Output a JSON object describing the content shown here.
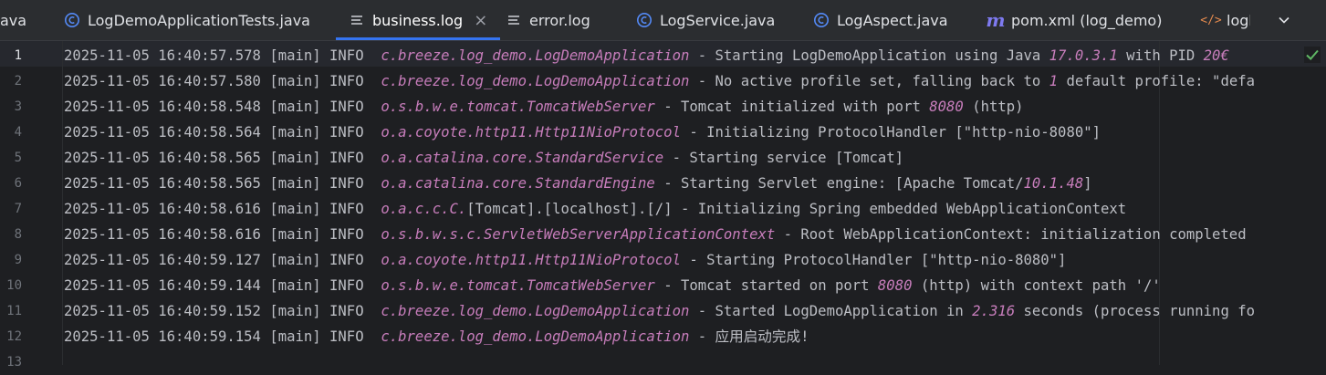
{
  "tabs": [
    {
      "label": "ava",
      "icon": "none",
      "active": false
    },
    {
      "label": "LogDemoApplicationTests.java",
      "icon": "java-class-icon",
      "active": false
    },
    {
      "label": "business.log",
      "icon": "log-file-icon",
      "active": true,
      "close": "×"
    },
    {
      "label": "error.log",
      "icon": "log-file-icon",
      "active": false
    },
    {
      "label": "LogService.java",
      "icon": "java-class-icon",
      "active": false
    },
    {
      "label": "LogAspect.java",
      "icon": "java-class-icon",
      "active": false
    },
    {
      "label": "pom.xml (log_demo)",
      "icon": "maven-icon",
      "active": false
    },
    {
      "label": "logb",
      "icon": "xml-icon",
      "active": false
    }
  ],
  "line_numbers": [
    "1",
    "2",
    "3",
    "4",
    "5",
    "6",
    "7",
    "8",
    "9",
    "10",
    "11",
    "12",
    "13"
  ],
  "log_lines": [
    {
      "prefix": "2025-11-05 16:40:57.578 [main] INFO  ",
      "logger": "c.breeze.log_demo.LogDemoApplication",
      "msg_a": " - Starting LogDemoApplication using Java ",
      "num": "17.0.3.1",
      "msg_b": " with PID ",
      "num2": "20€"
    },
    {
      "prefix": "2025-11-05 16:40:57.580 [main] INFO  ",
      "logger": "c.breeze.log_demo.LogDemoApplication",
      "msg_a": " - No active profile set, falling back to ",
      "num": "1",
      "msg_b": " default profile: \"defa",
      "num2": ""
    },
    {
      "prefix": "2025-11-05 16:40:58.548 [main] INFO  ",
      "logger": "o.s.b.w.e.tomcat.TomcatWebServer",
      "msg_a": " - Tomcat initialized with port ",
      "num": "8080",
      "msg_b": " (http)",
      "num2": ""
    },
    {
      "prefix": "2025-11-05 16:40:58.564 [main] INFO  ",
      "logger": "o.a.coyote.http11.Http11NioProtocol",
      "msg_a": " - Initializing ProtocolHandler [\"http-nio-8080\"]",
      "num": "",
      "msg_b": "",
      "num2": ""
    },
    {
      "prefix": "2025-11-05 16:40:58.565 [main] INFO  ",
      "logger": "o.a.catalina.core.StandardService",
      "msg_a": " - Starting service [Tomcat]",
      "num": "",
      "msg_b": "",
      "num2": ""
    },
    {
      "prefix": "2025-11-05 16:40:58.565 [main] INFO  ",
      "logger": "o.a.catalina.core.StandardEngine",
      "msg_a": " - Starting Servlet engine: [Apache Tomcat/",
      "num": "10.1.48",
      "msg_b": "]",
      "num2": ""
    },
    {
      "prefix": "2025-11-05 16:40:58.616 [main] INFO  ",
      "logger": "o.a.c.c.C.",
      "msg_a": "[Tomcat].[localhost].[/] - Initializing Spring embedded WebApplicationContext",
      "num": "",
      "msg_b": "",
      "num2": ""
    },
    {
      "prefix": "2025-11-05 16:40:58.616 [main] INFO  ",
      "logger": "o.s.b.w.s.c.ServletWebServerApplicationContext",
      "msg_a": " - Root WebApplicationContext: initialization completed",
      "num": "",
      "msg_b": "",
      "num2": ""
    },
    {
      "prefix": "2025-11-05 16:40:59.127 [main] INFO  ",
      "logger": "o.a.coyote.http11.Http11NioProtocol",
      "msg_a": " - Starting ProtocolHandler [\"http-nio-8080\"]",
      "num": "",
      "msg_b": "",
      "num2": ""
    },
    {
      "prefix": "2025-11-05 16:40:59.144 [main] INFO  ",
      "logger": "o.s.b.w.e.tomcat.TomcatWebServer",
      "msg_a": " - Tomcat started on port ",
      "num": "8080",
      "msg_b": " (http) with context path '/'",
      "num2": ""
    },
    {
      "prefix": "2025-11-05 16:40:59.152 [main] INFO  ",
      "logger": "c.breeze.log_demo.LogDemoApplication",
      "msg_a": " - Started LogDemoApplication in ",
      "num": "2.316",
      "msg_b": " seconds (process running fo",
      "num2": ""
    },
    {
      "prefix": "2025-11-05 16:40:59.154 [main] INFO  ",
      "logger": "c.breeze.log_demo.LogDemoApplication",
      "msg_a": " - 应用启动完成!",
      "num": "",
      "msg_b": "",
      "num2": ""
    },
    {
      "prefix": "",
      "logger": "",
      "msg_a": "",
      "num": "",
      "msg_b": "",
      "num2": ""
    }
  ],
  "colors": {
    "accent": "#3574f0",
    "logger": "#c77dbb",
    "text": "#bcbec4",
    "check": "#5fb865"
  }
}
